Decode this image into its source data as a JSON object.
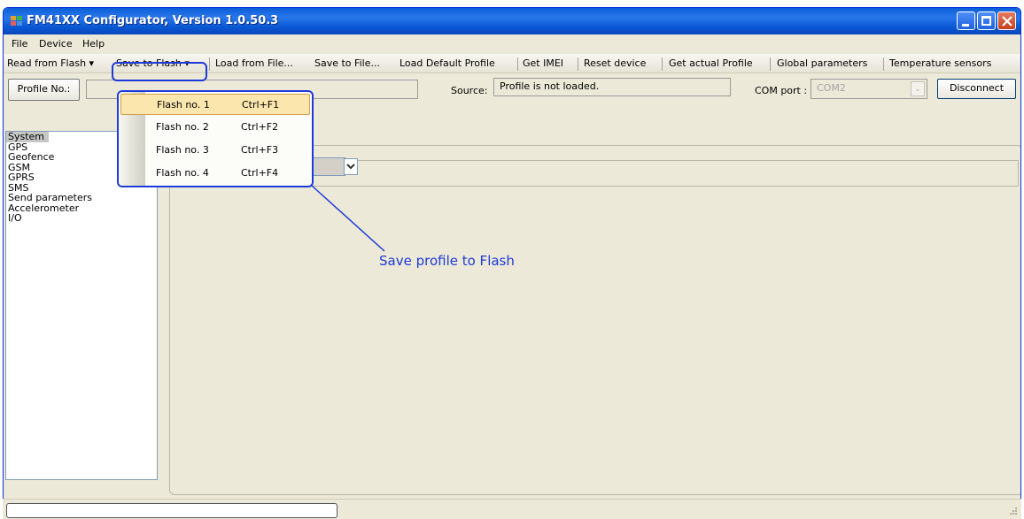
{
  "window": {
    "title": "FM41XX Configurator, Version 1.0.50.3"
  },
  "menu": {
    "items": [
      "File",
      "Device",
      "Help"
    ]
  },
  "toolbar": {
    "items": [
      {
        "label": "Read from Flash ▾"
      },
      {
        "label": "Save to Flash ▾"
      },
      {
        "label": "Load from File..."
      },
      {
        "label": "Save to File..."
      },
      {
        "label": "Load Default Profile"
      },
      {
        "label": "Get IMEI"
      },
      {
        "label": "Reset device"
      },
      {
        "label": "Get actual Profile"
      },
      {
        "label": "Global parameters"
      },
      {
        "label": "Temperature sensors"
      }
    ]
  },
  "profile_bar": {
    "profile_no_label": "Profile No.:",
    "source_label": "Source:",
    "source_value": "Profile is not loaded.",
    "com_port_label": "COM port :",
    "com_port_value": "COM2",
    "disconnect_label": "Disconnect"
  },
  "tree": {
    "items": [
      "System",
      "GPS",
      "Geofence",
      "GSM",
      "GPRS",
      "SMS",
      "Send parameters",
      "Accelerometer",
      "I/O"
    ]
  },
  "dropdown": {
    "items": [
      {
        "label": "Flash no. 1",
        "shortcut": "Ctrl+F1"
      },
      {
        "label": "Flash no. 2",
        "shortcut": "Ctrl+F2"
      },
      {
        "label": "Flash no. 3",
        "shortcut": "Ctrl+F3"
      },
      {
        "label": "Flash no. 4",
        "shortcut": "Ctrl+F4"
      }
    ]
  },
  "annotation": {
    "text": "Save profile to Flash"
  },
  "colors": {
    "titlebar": "#0a5fd8",
    "highlight": "#1e3ad8",
    "menu_active": "#fbe6ad"
  }
}
